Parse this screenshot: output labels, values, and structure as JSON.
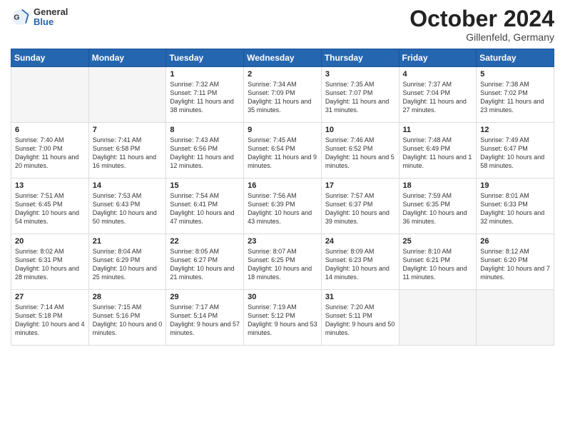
{
  "header": {
    "logo_general": "General",
    "logo_blue": "Blue",
    "title": "October 2024",
    "subtitle": "Gillenfeld, Germany"
  },
  "weekdays": [
    "Sunday",
    "Monday",
    "Tuesday",
    "Wednesday",
    "Thursday",
    "Friday",
    "Saturday"
  ],
  "weeks": [
    [
      {
        "day": "",
        "info": ""
      },
      {
        "day": "",
        "info": ""
      },
      {
        "day": "1",
        "info": "Sunrise: 7:32 AM\nSunset: 7:11 PM\nDaylight: 11 hours and 38 minutes."
      },
      {
        "day": "2",
        "info": "Sunrise: 7:34 AM\nSunset: 7:09 PM\nDaylight: 11 hours and 35 minutes."
      },
      {
        "day": "3",
        "info": "Sunrise: 7:35 AM\nSunset: 7:07 PM\nDaylight: 11 hours and 31 minutes."
      },
      {
        "day": "4",
        "info": "Sunrise: 7:37 AM\nSunset: 7:04 PM\nDaylight: 11 hours and 27 minutes."
      },
      {
        "day": "5",
        "info": "Sunrise: 7:38 AM\nSunset: 7:02 PM\nDaylight: 11 hours and 23 minutes."
      }
    ],
    [
      {
        "day": "6",
        "info": "Sunrise: 7:40 AM\nSunset: 7:00 PM\nDaylight: 11 hours and 20 minutes."
      },
      {
        "day": "7",
        "info": "Sunrise: 7:41 AM\nSunset: 6:58 PM\nDaylight: 11 hours and 16 minutes."
      },
      {
        "day": "8",
        "info": "Sunrise: 7:43 AM\nSunset: 6:56 PM\nDaylight: 11 hours and 12 minutes."
      },
      {
        "day": "9",
        "info": "Sunrise: 7:45 AM\nSunset: 6:54 PM\nDaylight: 11 hours and 9 minutes."
      },
      {
        "day": "10",
        "info": "Sunrise: 7:46 AM\nSunset: 6:52 PM\nDaylight: 11 hours and 5 minutes."
      },
      {
        "day": "11",
        "info": "Sunrise: 7:48 AM\nSunset: 6:49 PM\nDaylight: 11 hours and 1 minute."
      },
      {
        "day": "12",
        "info": "Sunrise: 7:49 AM\nSunset: 6:47 PM\nDaylight: 10 hours and 58 minutes."
      }
    ],
    [
      {
        "day": "13",
        "info": "Sunrise: 7:51 AM\nSunset: 6:45 PM\nDaylight: 10 hours and 54 minutes."
      },
      {
        "day": "14",
        "info": "Sunrise: 7:53 AM\nSunset: 6:43 PM\nDaylight: 10 hours and 50 minutes."
      },
      {
        "day": "15",
        "info": "Sunrise: 7:54 AM\nSunset: 6:41 PM\nDaylight: 10 hours and 47 minutes."
      },
      {
        "day": "16",
        "info": "Sunrise: 7:56 AM\nSunset: 6:39 PM\nDaylight: 10 hours and 43 minutes."
      },
      {
        "day": "17",
        "info": "Sunrise: 7:57 AM\nSunset: 6:37 PM\nDaylight: 10 hours and 39 minutes."
      },
      {
        "day": "18",
        "info": "Sunrise: 7:59 AM\nSunset: 6:35 PM\nDaylight: 10 hours and 36 minutes."
      },
      {
        "day": "19",
        "info": "Sunrise: 8:01 AM\nSunset: 6:33 PM\nDaylight: 10 hours and 32 minutes."
      }
    ],
    [
      {
        "day": "20",
        "info": "Sunrise: 8:02 AM\nSunset: 6:31 PM\nDaylight: 10 hours and 28 minutes."
      },
      {
        "day": "21",
        "info": "Sunrise: 8:04 AM\nSunset: 6:29 PM\nDaylight: 10 hours and 25 minutes."
      },
      {
        "day": "22",
        "info": "Sunrise: 8:05 AM\nSunset: 6:27 PM\nDaylight: 10 hours and 21 minutes."
      },
      {
        "day": "23",
        "info": "Sunrise: 8:07 AM\nSunset: 6:25 PM\nDaylight: 10 hours and 18 minutes."
      },
      {
        "day": "24",
        "info": "Sunrise: 8:09 AM\nSunset: 6:23 PM\nDaylight: 10 hours and 14 minutes."
      },
      {
        "day": "25",
        "info": "Sunrise: 8:10 AM\nSunset: 6:21 PM\nDaylight: 10 hours and 11 minutes."
      },
      {
        "day": "26",
        "info": "Sunrise: 8:12 AM\nSunset: 6:20 PM\nDaylight: 10 hours and 7 minutes."
      }
    ],
    [
      {
        "day": "27",
        "info": "Sunrise: 7:14 AM\nSunset: 5:18 PM\nDaylight: 10 hours and 4 minutes."
      },
      {
        "day": "28",
        "info": "Sunrise: 7:15 AM\nSunset: 5:16 PM\nDaylight: 10 hours and 0 minutes."
      },
      {
        "day": "29",
        "info": "Sunrise: 7:17 AM\nSunset: 5:14 PM\nDaylight: 9 hours and 57 minutes."
      },
      {
        "day": "30",
        "info": "Sunrise: 7:19 AM\nSunset: 5:12 PM\nDaylight: 9 hours and 53 minutes."
      },
      {
        "day": "31",
        "info": "Sunrise: 7:20 AM\nSunset: 5:11 PM\nDaylight: 9 hours and 50 minutes."
      },
      {
        "day": "",
        "info": ""
      },
      {
        "day": "",
        "info": ""
      }
    ]
  ]
}
